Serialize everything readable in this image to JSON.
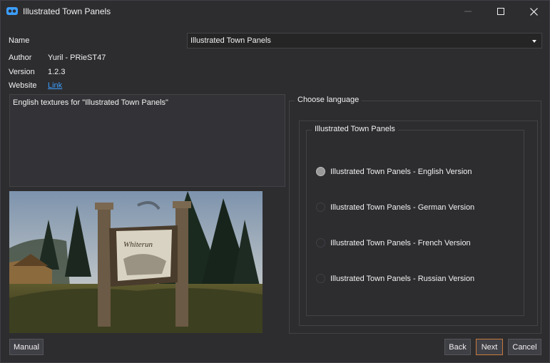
{
  "window": {
    "title": "Illustrated Town Panels",
    "minimize_icon": "minimize-icon",
    "maximize_icon": "maximize-icon",
    "close_icon": "close-icon"
  },
  "fields": {
    "name_label": "Name",
    "name_value": "Illustrated Town Panels",
    "author_label": "Author",
    "author_value": "Yuril - PRieST47",
    "version_label": "Version",
    "version_value": "1.2.3",
    "website_label": "Website",
    "website_link": "Link"
  },
  "description": "English textures for \"Illustrated Town Panels\"",
  "preview": {
    "sign_text": "Whiterun"
  },
  "language": {
    "title": "Choose language",
    "group_title": "Illustrated Town Panels",
    "options": [
      {
        "label": "Illustrated Town Panels - English Version",
        "checked": true
      },
      {
        "label": "Illustrated Town Panels - German Version",
        "checked": false
      },
      {
        "label": "Illustrated Town Panels - French Version",
        "checked": false
      },
      {
        "label": "Illustrated Town Panels - Russian Version",
        "checked": false
      }
    ]
  },
  "buttons": {
    "manual": "Manual",
    "back": "Back",
    "next": "Next",
    "cancel": "Cancel"
  },
  "colors": {
    "background": "#2d2d30",
    "link": "#3c9fff",
    "accent": "#c77a3b"
  }
}
